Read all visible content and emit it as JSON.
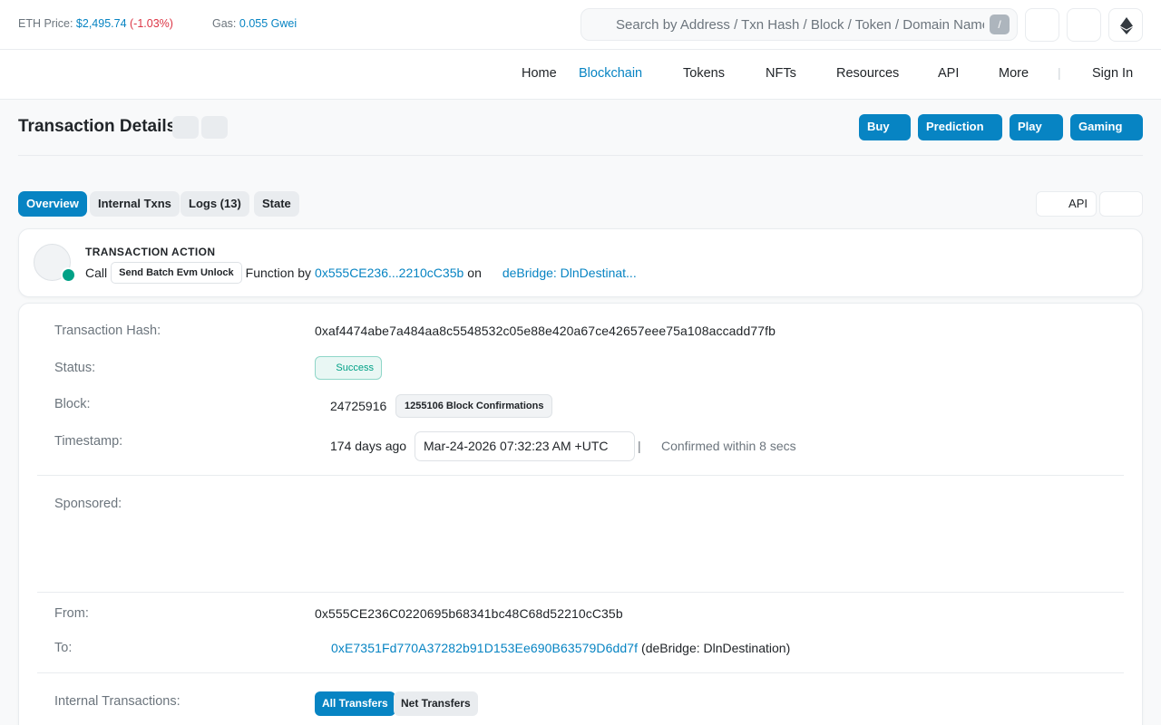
{
  "topbar": {
    "eth_price_label": "ETH Price:",
    "eth_price_value": "$2,495.74",
    "eth_price_change": "(-1.03%)",
    "gas_label": "Gas:",
    "gas_value": "0.055 Gwei",
    "search_placeholder": "Search by Address / Txn Hash / Block / Token / Domain Name",
    "search_shortcut": "/"
  },
  "nav": {
    "items": [
      "Home",
      "Blockchain",
      "Tokens",
      "NFTs",
      "Resources",
      "API",
      "More"
    ],
    "active": "Blockchain",
    "sign_in": "Sign In"
  },
  "page": {
    "title": "Transaction Details",
    "promo_buttons": [
      "Buy",
      "Prediction",
      "Play",
      "Gaming"
    ]
  },
  "tabs": {
    "items": [
      "Overview",
      "Internal Txns",
      "Logs (13)",
      "State"
    ],
    "active": "Overview",
    "api_label": "API"
  },
  "action": {
    "label": "TRANSACTION ACTION",
    "call": "Call",
    "method": "Send Batch Evm Unlock",
    "function_by": "Function by",
    "from_short": "0x555CE236...2210cC35b",
    "on": "on",
    "contract": "deBridge: DlnDestinat..."
  },
  "details": {
    "hash_label": "Transaction Hash:",
    "hash": "0xaf4474abe7a484aa8c5548532c05e88e420a67ce42657eee75a108accadd77fb",
    "status_label": "Status:",
    "status": "Success",
    "block_label": "Block:",
    "block": "24725916",
    "confirmations": "1255106 Block Confirmations",
    "timestamp_label": "Timestamp:",
    "age": "174 days ago",
    "timestamp": "Mar-24-2026 07:32:23 AM +UTC",
    "ts_sep": "|",
    "confirmed": "Confirmed within 8 secs",
    "sponsored_label": "Sponsored:",
    "from_label": "From:",
    "from": "0x555CE236C0220695b68341bc48C68d52210cC35b",
    "to_label": "To:",
    "to": "0xE7351Fd770A37282b91D153Ee690B63579D6dd7f",
    "to_name": "(deBridge: DlnDestination)",
    "internal_label": "Internal Transactions:",
    "all_transfers": "All Transfers",
    "net_transfers": "Net Transfers"
  },
  "colors": {
    "accent": "#0784c3",
    "success": "#00a186",
    "negative": "#dc3545"
  }
}
